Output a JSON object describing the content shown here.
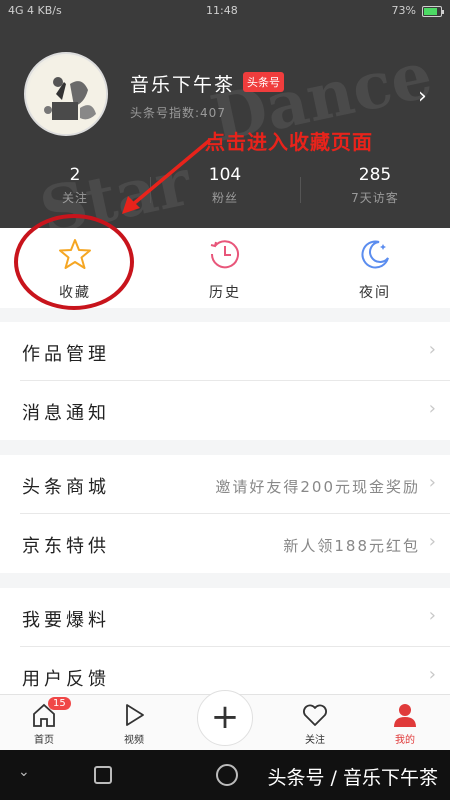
{
  "status_bar": {
    "signal": "4G",
    "speed": "4 KB/s",
    "time": "11:48",
    "battery": "73%"
  },
  "profile": {
    "username": "音乐下午茶",
    "badge": "头条号",
    "index_label": "头条号指数:407"
  },
  "annotation": {
    "text": "点击进入收藏页面",
    "color": "#e8231b"
  },
  "stats": [
    {
      "value": "2",
      "label": "关注"
    },
    {
      "value": "104",
      "label": "粉丝"
    },
    {
      "value": "285",
      "label": "7天访客"
    }
  ],
  "quick_actions": [
    {
      "label": "收藏",
      "icon": "star-icon",
      "color": "#f5a623"
    },
    {
      "label": "历史",
      "icon": "clock-icon",
      "color": "#e8567a"
    },
    {
      "label": "夜间",
      "icon": "moon-icon",
      "color": "#5b8def"
    }
  ],
  "menu_groups": [
    [
      {
        "title": "作品管理"
      },
      {
        "title": "消息通知"
      }
    ],
    [
      {
        "title": "头条商城",
        "subtitle": "邀请好友得200元现金奖励"
      },
      {
        "title": "京东特供",
        "subtitle": "新人领188元红包"
      }
    ],
    [
      {
        "title": "我要爆料"
      },
      {
        "title": "用户反馈"
      }
    ]
  ],
  "tabbar": {
    "tabs": [
      {
        "label": "首页",
        "icon": "home-icon",
        "badge": "15"
      },
      {
        "label": "视频",
        "icon": "play-icon"
      },
      {
        "label": "关注",
        "icon": "heart-icon"
      },
      {
        "label": "我的",
        "icon": "person-icon",
        "active": true
      }
    ],
    "plus_icon": "plus-icon"
  },
  "watermark": "头条号 / 音乐下午茶",
  "colors": {
    "header_bg": "#3b3b3b",
    "accent_red": "#e03a3a",
    "star": "#f5a623"
  }
}
